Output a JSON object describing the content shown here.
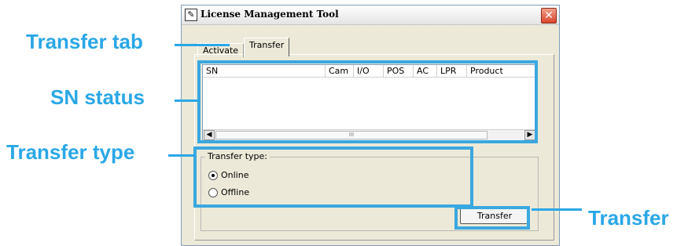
{
  "window": {
    "title": "License Management Tool",
    "icon": "license-tool-icon",
    "close_icon": "close-icon"
  },
  "tabs": [
    {
      "label": "Activate",
      "selected": false
    },
    {
      "label": "Transfer",
      "selected": true
    }
  ],
  "listview": {
    "columns": [
      "SN",
      "Cam",
      "I/O",
      "POS",
      "AC",
      "LPR",
      "Product"
    ],
    "rows": [],
    "scroll_left_icon": "arrow-left-icon",
    "scroll_right_icon": "arrow-right-icon",
    "thumb_grip": "III"
  },
  "transfer_type": {
    "label": "Transfer type:",
    "options": [
      {
        "label": "Online",
        "checked": true
      },
      {
        "label": "Offline",
        "checked": false
      }
    ]
  },
  "button_label": "Transfer",
  "callouts": {
    "transfer_tab": "Transfer tab",
    "sn_status": "SN status",
    "transfer_type": "Transfer type",
    "transfer": "Transfer"
  },
  "colors": {
    "callout": "#2aa7e6",
    "window_bg": "#ece9d8",
    "close_button": "#d9452c"
  }
}
